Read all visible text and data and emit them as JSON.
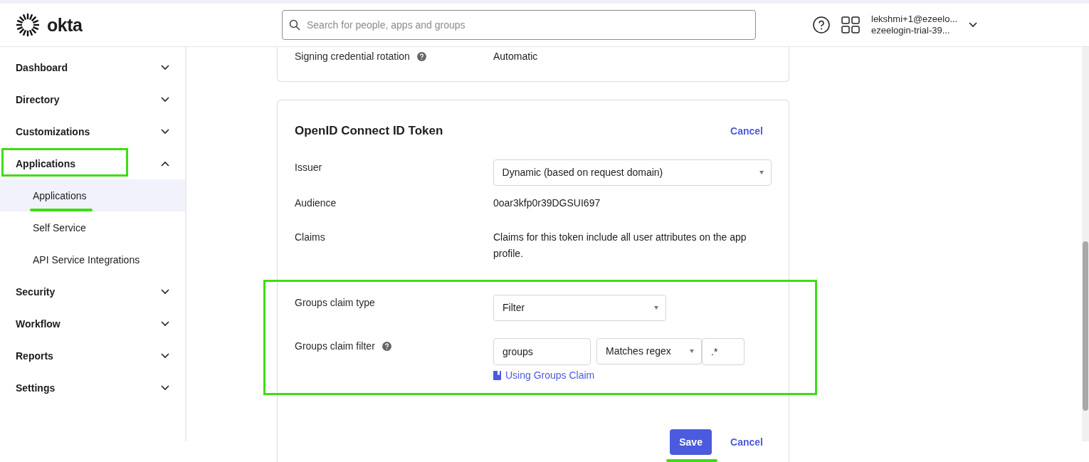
{
  "header": {
    "logo": "okta",
    "search": {
      "placeholder": "Search for people, apps and groups"
    },
    "user": {
      "email": "lekshmi+1@ezeelo...",
      "org": "ezeelogin-trial-39..."
    }
  },
  "sidebar": {
    "items": [
      {
        "label": "Dashboard",
        "expanded": false,
        "highlighted": false
      },
      {
        "label": "Directory",
        "expanded": false,
        "highlighted": false
      },
      {
        "label": "Customizations",
        "expanded": false,
        "highlighted": false
      },
      {
        "label": "Applications",
        "expanded": true,
        "highlighted": true,
        "children": [
          {
            "label": "Applications",
            "selected": true,
            "highlighted": true
          },
          {
            "label": "Self Service",
            "selected": false,
            "highlighted": false
          },
          {
            "label": "API Service Integrations",
            "selected": false,
            "highlighted": false
          }
        ]
      },
      {
        "label": "Security",
        "expanded": false,
        "highlighted": false
      },
      {
        "label": "Workflow",
        "expanded": false,
        "highlighted": false
      },
      {
        "label": "Reports",
        "expanded": false,
        "highlighted": false
      },
      {
        "label": "Settings",
        "expanded": false,
        "highlighted": false
      }
    ]
  },
  "signing_card": {
    "label": "Signing credential rotation",
    "value": "Automatic"
  },
  "token_card": {
    "title": "OpenID Connect ID Token",
    "cancel_link": "Cancel",
    "rows": [
      {
        "kind": "select",
        "label": "Issuer",
        "value": "Dynamic (based on request domain)"
      },
      {
        "kind": "text",
        "label": "Audience",
        "value": "0oar3kfp0r39DGSUI697"
      },
      {
        "kind": "text",
        "label": "Claims",
        "value": "Claims for this token include all user attributes on the app profile."
      }
    ],
    "groups_section": {
      "highlighted": true,
      "claim_type": {
        "label": "Groups claim type",
        "value": "Filter"
      },
      "claim_filter": {
        "label": "Groups claim filter",
        "name": "groups",
        "operator": "Matches regex",
        "pattern": ".*",
        "help_link": "Using Groups Claim"
      }
    },
    "save_button": {
      "label": "Save",
      "highlighted": true
    },
    "cancel_button": "Cancel"
  }
}
